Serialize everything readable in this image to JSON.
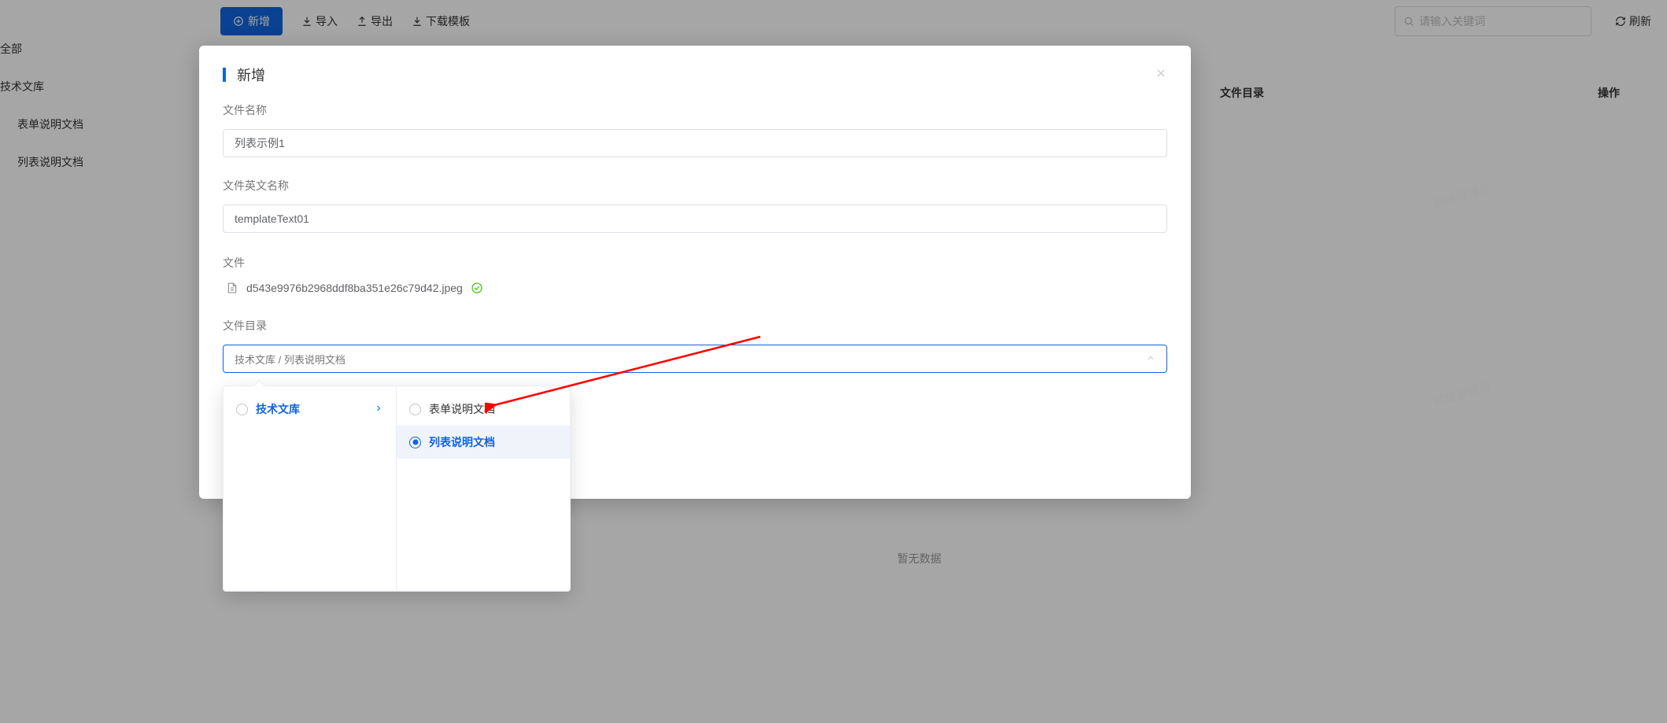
{
  "sidebar": {
    "root": "全部",
    "group": "技术文库",
    "items": [
      "表单说明文档",
      "列表说明文档"
    ]
  },
  "toolbar": {
    "add": "新增",
    "import": "导入",
    "export": "导出",
    "download_tpl": "下载模板",
    "search_placeholder": "请输入关键词",
    "refresh": "刷新"
  },
  "table": {
    "col_dir": "文件目录",
    "col_op": "操作",
    "empty": "暂无数据"
  },
  "modal": {
    "title": "新增",
    "labels": {
      "file_name": "文件名称",
      "file_en_name": "文件英文名称",
      "file": "文件",
      "file_dir": "文件目录"
    },
    "values": {
      "file_name": "列表示例1",
      "file_en_name": "templateText01",
      "uploaded_file": "d543e9976b2968ddf8ba351e26c79d42.jpeg",
      "dir_path": "技术文库 / 列表说明文档"
    }
  },
  "cascader": {
    "level1": [
      {
        "label": "技术文库",
        "active": true
      }
    ],
    "level2": [
      {
        "label": "表单说明文档",
        "selected": false
      },
      {
        "label": "列表说明文档",
        "selected": true
      }
    ]
  },
  "watermark": "超级管理员"
}
